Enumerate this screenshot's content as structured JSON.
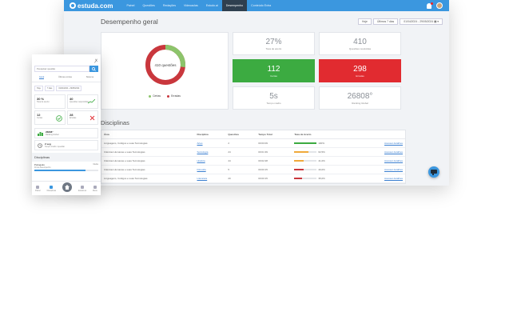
{
  "nav": {
    "brand": "estuda.com",
    "links": [
      "Painel",
      "Questões",
      "Redações",
      "Videoaulas",
      "Estudo.ai",
      "Desempenho",
      "Conteúdo Extra"
    ],
    "active_index": 5
  },
  "main": {
    "title": "Desempenho geral",
    "filters": [
      "Hoje",
      "Últimos 7 dias",
      "01/04/2024 - 29/05/2024"
    ]
  },
  "donut": {
    "center_label": "410 questões",
    "legend_correct": "Certas",
    "legend_wrong": "Erradas",
    "correct_fraction": 0.27,
    "color_correct": "#8cc46b",
    "color_wrong": "#c9373d"
  },
  "stats": {
    "rate": {
      "value": "27%",
      "label": "Taxa de acerto"
    },
    "solved": {
      "value": "410",
      "label": "Questões resolvidas"
    },
    "correct": {
      "value": "112",
      "label": "Certas"
    },
    "wrong": {
      "value": "298",
      "label": "Erradas"
    },
    "time": {
      "value": "5s",
      "label": "Tempo médio"
    },
    "ranking": {
      "value": "26808°",
      "label": "Ranking Global"
    }
  },
  "disciplines": {
    "title": "Disciplinas",
    "headers": [
      "Área",
      "Disciplina",
      "Questões",
      "Tempo Total",
      "Taxa de Acerto",
      ""
    ],
    "rows": [
      {
        "area": "Linguagens, Códigos e suas Tecnologias",
        "disc": "Artes",
        "q": "2",
        "time": "00:00:09",
        "rate": "100%",
        "frac": 1.0,
        "color": "#3cab41",
        "link": "Acessar detalhes"
      },
      {
        "area": "Ciências Humanas e suas Tecnologias",
        "disc": "Sociologia",
        "q": "24",
        "time": "00:01:39",
        "rate": "62,5%",
        "frac": 0.625,
        "color": "#f0a93b",
        "link": "Acessar detalhes"
      },
      {
        "area": "Ciências Humanas e suas Tecnologias",
        "disc": "História",
        "q": "44",
        "time": "00:02:28",
        "rate": "41,0%",
        "frac": 0.41,
        "color": "#f0a93b",
        "link": "Acessar detalhes"
      },
      {
        "area": "Ciências Humanas e suas Tecnologias",
        "disc": "Filosofia",
        "q": "5",
        "time": "00:00:15",
        "rate": "40,0%",
        "frac": 0.4,
        "color": "#c9373d",
        "link": "Acessar detalhes"
      },
      {
        "area": "Linguagens, Códigos e suas Tecnologias",
        "disc": "Literatura",
        "q": "20",
        "time": "00:00:15",
        "rate": "35,0%",
        "frac": 0.35,
        "color": "#c9373d",
        "link": "Acessar detalhes"
      }
    ]
  },
  "mobile": {
    "search_placeholder": "Pesquisar questão",
    "tabs": [
      "Geral",
      "Últimas contas",
      "Sistema"
    ],
    "filters": [
      "Hoje",
      "7 dias",
      "01/04/2024 - 29/05/2024"
    ],
    "cards": [
      {
        "value": "30 %",
        "label": "Taxa de acerto"
      },
      {
        "value": "40",
        "label": "Questões respondidas"
      },
      {
        "value": "12",
        "label": "Certas"
      },
      {
        "value": "28",
        "label": "Erradas"
      }
    ],
    "ranking": {
      "value": "26808°",
      "label": "Ranking Global"
    },
    "time": {
      "value": "2 seg",
      "label": "Tempo médio / questão"
    },
    "disc_title": "Disciplinas",
    "disc": {
      "name": "Português",
      "sub": "40 de desempenho",
      "tag": "Media",
      "frac": 0.8
    },
    "nav": [
      "Painel",
      "Disciplinas",
      "",
      "Estudo.ai",
      "Menu"
    ]
  }
}
